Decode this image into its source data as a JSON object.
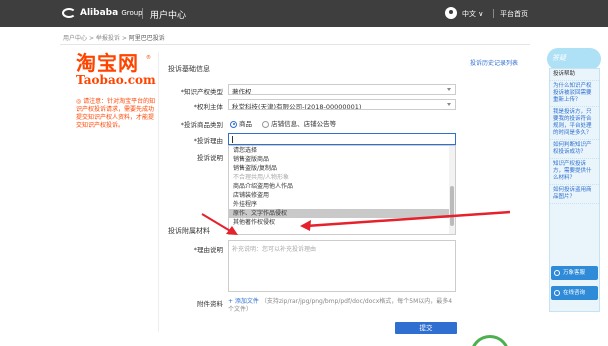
{
  "header": {
    "brand": "Alibaba",
    "brand_group": "Group",
    "section": "用户中心",
    "lang": "中文 ∨",
    "home": "平台首页"
  },
  "breadcrumb": {
    "items": [
      "用户中心",
      ">",
      "举报投诉",
      ">",
      "阿里巴巴投诉"
    ]
  },
  "sidebar_logo": {
    "cn": "淘宝网",
    "en": "Taobao.com",
    "reg": "®"
  },
  "notice": "◎ 请注意：针对淘宝平台的知识产权投诉请求，需要先成功提交知识产权人资料，才能提交知识产权投诉。",
  "form": {
    "section_title": "投诉基础信息",
    "history_link": "投诉历史记录列表",
    "fields": {
      "ip_type_label": "*知识产权类型",
      "ip_type_value": "著作权",
      "holder_label": "*权利主体",
      "holder_value": "秋堂科技(天津)有限公司-(2018-00000001)",
      "category_label": "*投诉商品类别",
      "category_options": [
        "商品",
        "店铺信息、店铺公告等"
      ],
      "reason_label": "*投诉理由",
      "desc_label": "投诉说明"
    },
    "dropdown_items": [
      "请您选择",
      "销售盗版商品",
      "销售盗版/复制品",
      "不合理共用/人物形象",
      "商品介绍盗用他人作品",
      "店铺装修盗用",
      "外挂程序",
      "原作、文字作品侵权",
      "其他著作权侵权"
    ],
    "dropdown_disabled_index": 3,
    "dropdown_selected_index": 7,
    "section2_title": "投诉附属材料",
    "reason_detail_label": "*理由说明",
    "reason_placeholder": "补充说明：您可以补充投诉理由",
    "attach_label": "附件资料",
    "attach_link": "+ 添加文件",
    "attach_hint": "（支持zip/rar/jpg/png/bmp/pdf/doc/docx格式，每个5M以内，最多4个文件）",
    "submit": "提交"
  },
  "right_panel": {
    "cloud": "答疑",
    "items": [
      {
        "q": "投诉帮助"
      },
      {
        "q": "为什么知识产权投诉被驳回需要重新上传？"
      },
      {
        "q": "我是投诉方，只要我的投诉符合规则，平台处理的时间是多久？"
      },
      {
        "q": "如何判断知识产权投诉成功？"
      },
      {
        "q": "知识产权投诉方，需要提供什么材料？"
      },
      {
        "q": "如何投诉盗用商品图片？"
      }
    ],
    "btn_service": "万象客服",
    "btn_help": "在线咨询"
  }
}
